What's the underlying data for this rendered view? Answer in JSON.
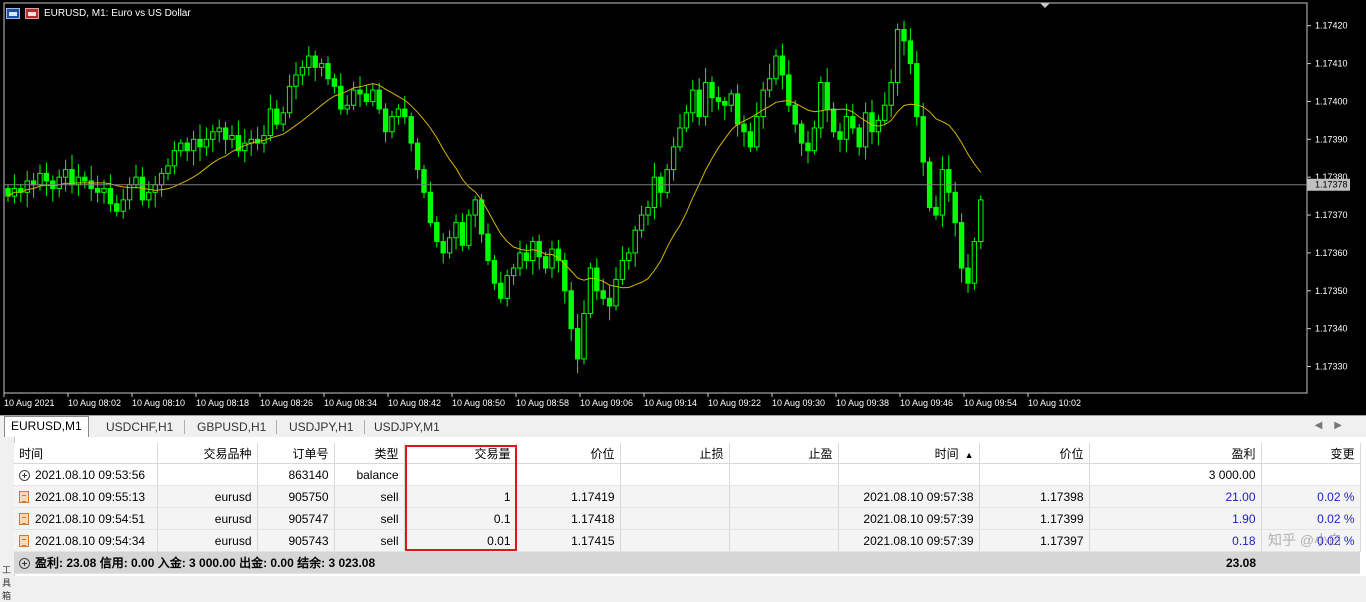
{
  "window": {
    "title": "EURUSD, M1:  Euro vs US Dollar",
    "icons": [
      "window-icon",
      "chart-icon"
    ]
  },
  "chart_data": {
    "type": "candlestick",
    "symbol": "EURUSD",
    "timeframe": "M1",
    "current_price": "1.17378",
    "y_ticks": [
      "1.17420",
      "1.17410",
      "1.17400",
      "1.17390",
      "1.17380",
      "1.17370",
      "1.17360",
      "1.17350",
      "1.17340",
      "1.17330"
    ],
    "ylim": [
      1.17323,
      1.17426
    ],
    "x_ticks": [
      "10 Aug 2021",
      "10 Aug 08:02",
      "10 Aug 08:10",
      "10 Aug 08:18",
      "10 Aug 08:26",
      "10 Aug 08:34",
      "10 Aug 08:42",
      "10 Aug 08:50",
      "10 Aug 08:58",
      "10 Aug 09:06",
      "10 Aug 09:14",
      "10 Aug 09:22",
      "10 Aug 09:30",
      "10 Aug 09:38",
      "10 Aug 09:46",
      "10 Aug 09:54",
      "10 Aug 10:02"
    ],
    "close": [
      1.17375,
      1.17377,
      1.17376,
      1.17379,
      1.17378,
      1.17381,
      1.17379,
      1.17377,
      1.1738,
      1.17382,
      1.17378,
      1.1738,
      1.17379,
      1.17377,
      1.17376,
      1.17377,
      1.17373,
      1.17371,
      1.17374,
      1.17378,
      1.1738,
      1.17374,
      1.17376,
      1.17378,
      1.17381,
      1.17383,
      1.17387,
      1.17389,
      1.17387,
      1.1739,
      1.17388,
      1.1739,
      1.17392,
      1.17393,
      1.1739,
      1.17391,
      1.17387,
      1.17389,
      1.1739,
      1.17389,
      1.17391,
      1.17398,
      1.17394,
      1.17397,
      1.17404,
      1.17407,
      1.17409,
      1.17412,
      1.17409,
      1.1741,
      1.17406,
      1.17404,
      1.17398,
      1.17399,
      1.17403,
      1.17402,
      1.174,
      1.17403,
      1.17398,
      1.17392,
      1.17396,
      1.17398,
      1.17396,
      1.17389,
      1.17382,
      1.17376,
      1.17368,
      1.17363,
      1.1736,
      1.17364,
      1.17368,
      1.17362,
      1.1737,
      1.17374,
      1.17365,
      1.17358,
      1.17352,
      1.17348,
      1.17354,
      1.17356,
      1.1736,
      1.17358,
      1.17363,
      1.17359,
      1.17356,
      1.17361,
      1.17358,
      1.1735,
      1.1734,
      1.17332,
      1.17344,
      1.17356,
      1.1735,
      1.17348,
      1.17346,
      1.17353,
      1.17358,
      1.1736,
      1.17366,
      1.1737,
      1.17372,
      1.1738,
      1.17376,
      1.17382,
      1.17388,
      1.17393,
      1.17397,
      1.17403,
      1.17396,
      1.17405,
      1.17401,
      1.174,
      1.17399,
      1.17402,
      1.17394,
      1.17392,
      1.17388,
      1.17396,
      1.17403,
      1.17406,
      1.17412,
      1.17407,
      1.17399,
      1.17394,
      1.17389,
      1.17387,
      1.17393,
      1.17405,
      1.17398,
      1.17392,
      1.1739,
      1.17396,
      1.17393,
      1.17388,
      1.17397,
      1.17392,
      1.17395,
      1.17399,
      1.17405,
      1.17419,
      1.17416,
      1.1741,
      1.17396,
      1.17384,
      1.17372,
      1.1737,
      1.17382,
      1.17376,
      1.17368,
      1.17356,
      1.17352,
      1.17363,
      1.17374
    ]
  },
  "tabs": [
    "EURUSD,M1",
    "USDCHF,H1",
    "GBPUSD,H1",
    "USDJPY,H1",
    "USDJPY,M1"
  ],
  "table": {
    "headers": {
      "time": "时间",
      "symbol": "交易品种",
      "ticket": "订单号",
      "type": "类型",
      "volume": "交易量",
      "price": "价位",
      "sl": "止损",
      "tp": "止盈",
      "time2": "时间",
      "price2": "价位",
      "profit": "盈利",
      "change": "变更"
    },
    "sort_arrow": "▲",
    "rows": [
      {
        "time": "2021.08.10 09:53:56",
        "symbol": "",
        "ticket": "863140",
        "type": "balance",
        "volume": "",
        "price": "",
        "sl": "",
        "tp": "",
        "time2": "",
        "price2": "",
        "profit": "3 000.00",
        "change": ""
      },
      {
        "time": "2021.08.10 09:55:13",
        "symbol": "eurusd",
        "ticket": "905750",
        "type": "sell",
        "volume": "1",
        "price": "1.17419",
        "sl": "",
        "tp": "",
        "time2": "2021.08.10 09:57:38",
        "price2": "1.17398",
        "profit": "21.00",
        "change": "0.02 %"
      },
      {
        "time": "2021.08.10 09:54:51",
        "symbol": "eurusd",
        "ticket": "905747",
        "type": "sell",
        "volume": "0.1",
        "price": "1.17418",
        "sl": "",
        "tp": "",
        "time2": "2021.08.10 09:57:39",
        "price2": "1.17399",
        "profit": "1.90",
        "change": "0.02 %"
      },
      {
        "time": "2021.08.10 09:54:34",
        "symbol": "eurusd",
        "ticket": "905743",
        "type": "sell",
        "volume": "0.01",
        "price": "1.17415",
        "sl": "",
        "tp": "",
        "time2": "2021.08.10 09:57:39",
        "price2": "1.17397",
        "profit": "0.18",
        "change": "0.02 %"
      }
    ],
    "summary": "盈利: 23.08  信用: 0.00  入金: 3 000.00  出金: 0.00  结余: 3 023.08",
    "summary_total": "23.08"
  },
  "side_label": "工具箱",
  "watermark": "知乎 @小白",
  "colors": {
    "chart_bg": "#000000",
    "candle": "#00ff00",
    "ma_line": "#d4b400",
    "price_line": "#808080",
    "highlight_box": "#e0141a",
    "profit_text": "#1c1ccc"
  }
}
